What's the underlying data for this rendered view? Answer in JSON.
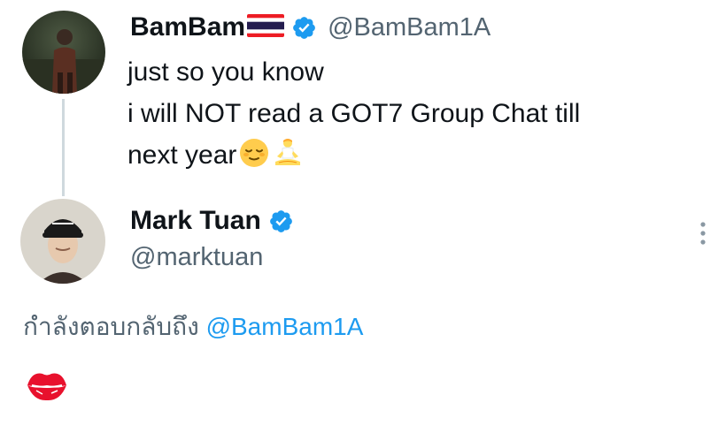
{
  "tweet": {
    "author": {
      "display_name": "BamBam",
      "flag": "Thailand flag",
      "handle": "@BamBam1A"
    },
    "lines": [
      "just so you know",
      "i will NOT read a GOT7 Group Chat till",
      "next year"
    ],
    "emojis": [
      "relieved-face",
      "person-in-lotus-position"
    ]
  },
  "reply": {
    "author": {
      "display_name": "Mark Tuan",
      "handle": "@marktuan"
    },
    "replying_to_label": "กำลังตอบกลับถึง",
    "replying_to_handle": "@BamBam1A",
    "content_emoji": "kiss-mark"
  },
  "colors": {
    "text": "#0f1419",
    "secondary": "#536471",
    "accent": "#1d9bf0",
    "thread_line": "#cfd9de",
    "kiss": "#e8112d"
  }
}
